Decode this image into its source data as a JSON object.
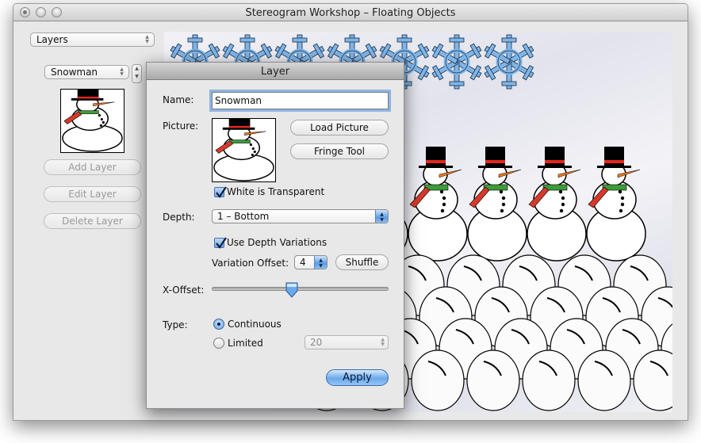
{
  "window": {
    "title": "Stereogram Workshop – Floating Objects"
  },
  "left_panel": {
    "mode_popup": {
      "value": "Layers"
    },
    "layer_popup": {
      "value": "Snowman"
    },
    "thumbnail_icon": "snowman-image",
    "buttons": {
      "add": "Add Layer",
      "edit": "Edit Layer",
      "delete": "Delete Layer"
    }
  },
  "preview": {
    "rows": [
      {
        "object": "snowflake",
        "count": 7
      },
      {
        "object": "snowman",
        "count": 5
      },
      {
        "object": "snowball",
        "rows": 4
      }
    ],
    "colors": {
      "snowflake_fill": "#7fb6e8",
      "snowflake_stroke": "#1a2a44",
      "hat": "#000000",
      "hat_band": "#e3261f",
      "nose": "#f07a1e",
      "scarf_red": "#d6392a",
      "scarf_green": "#3d9b3a"
    }
  },
  "dialog": {
    "title": "Layer",
    "name_label": "Name:",
    "name_value": "Snowman",
    "picture_label": "Picture:",
    "load_picture": "Load Picture",
    "fringe_tool": "Fringe Tool",
    "white_transparent": {
      "label": "White is Transparent",
      "checked": true
    },
    "depth_label": "Depth:",
    "depth_value": "1 – Bottom",
    "use_depth_variations": {
      "label": "Use Depth Variations",
      "checked": true
    },
    "variation_offset_label": "Variation Offset:",
    "variation_offset_value": "4",
    "shuffle": "Shuffle",
    "x_offset_label": "X-Offset:",
    "x_offset_fraction": 0.45,
    "type_label": "Type:",
    "type_options": [
      {
        "label": "Continuous",
        "selected": true
      },
      {
        "label": "Limited",
        "selected": false
      }
    ],
    "limited_value": "20",
    "apply": "Apply"
  },
  "accent_color": "#5a9ae4"
}
